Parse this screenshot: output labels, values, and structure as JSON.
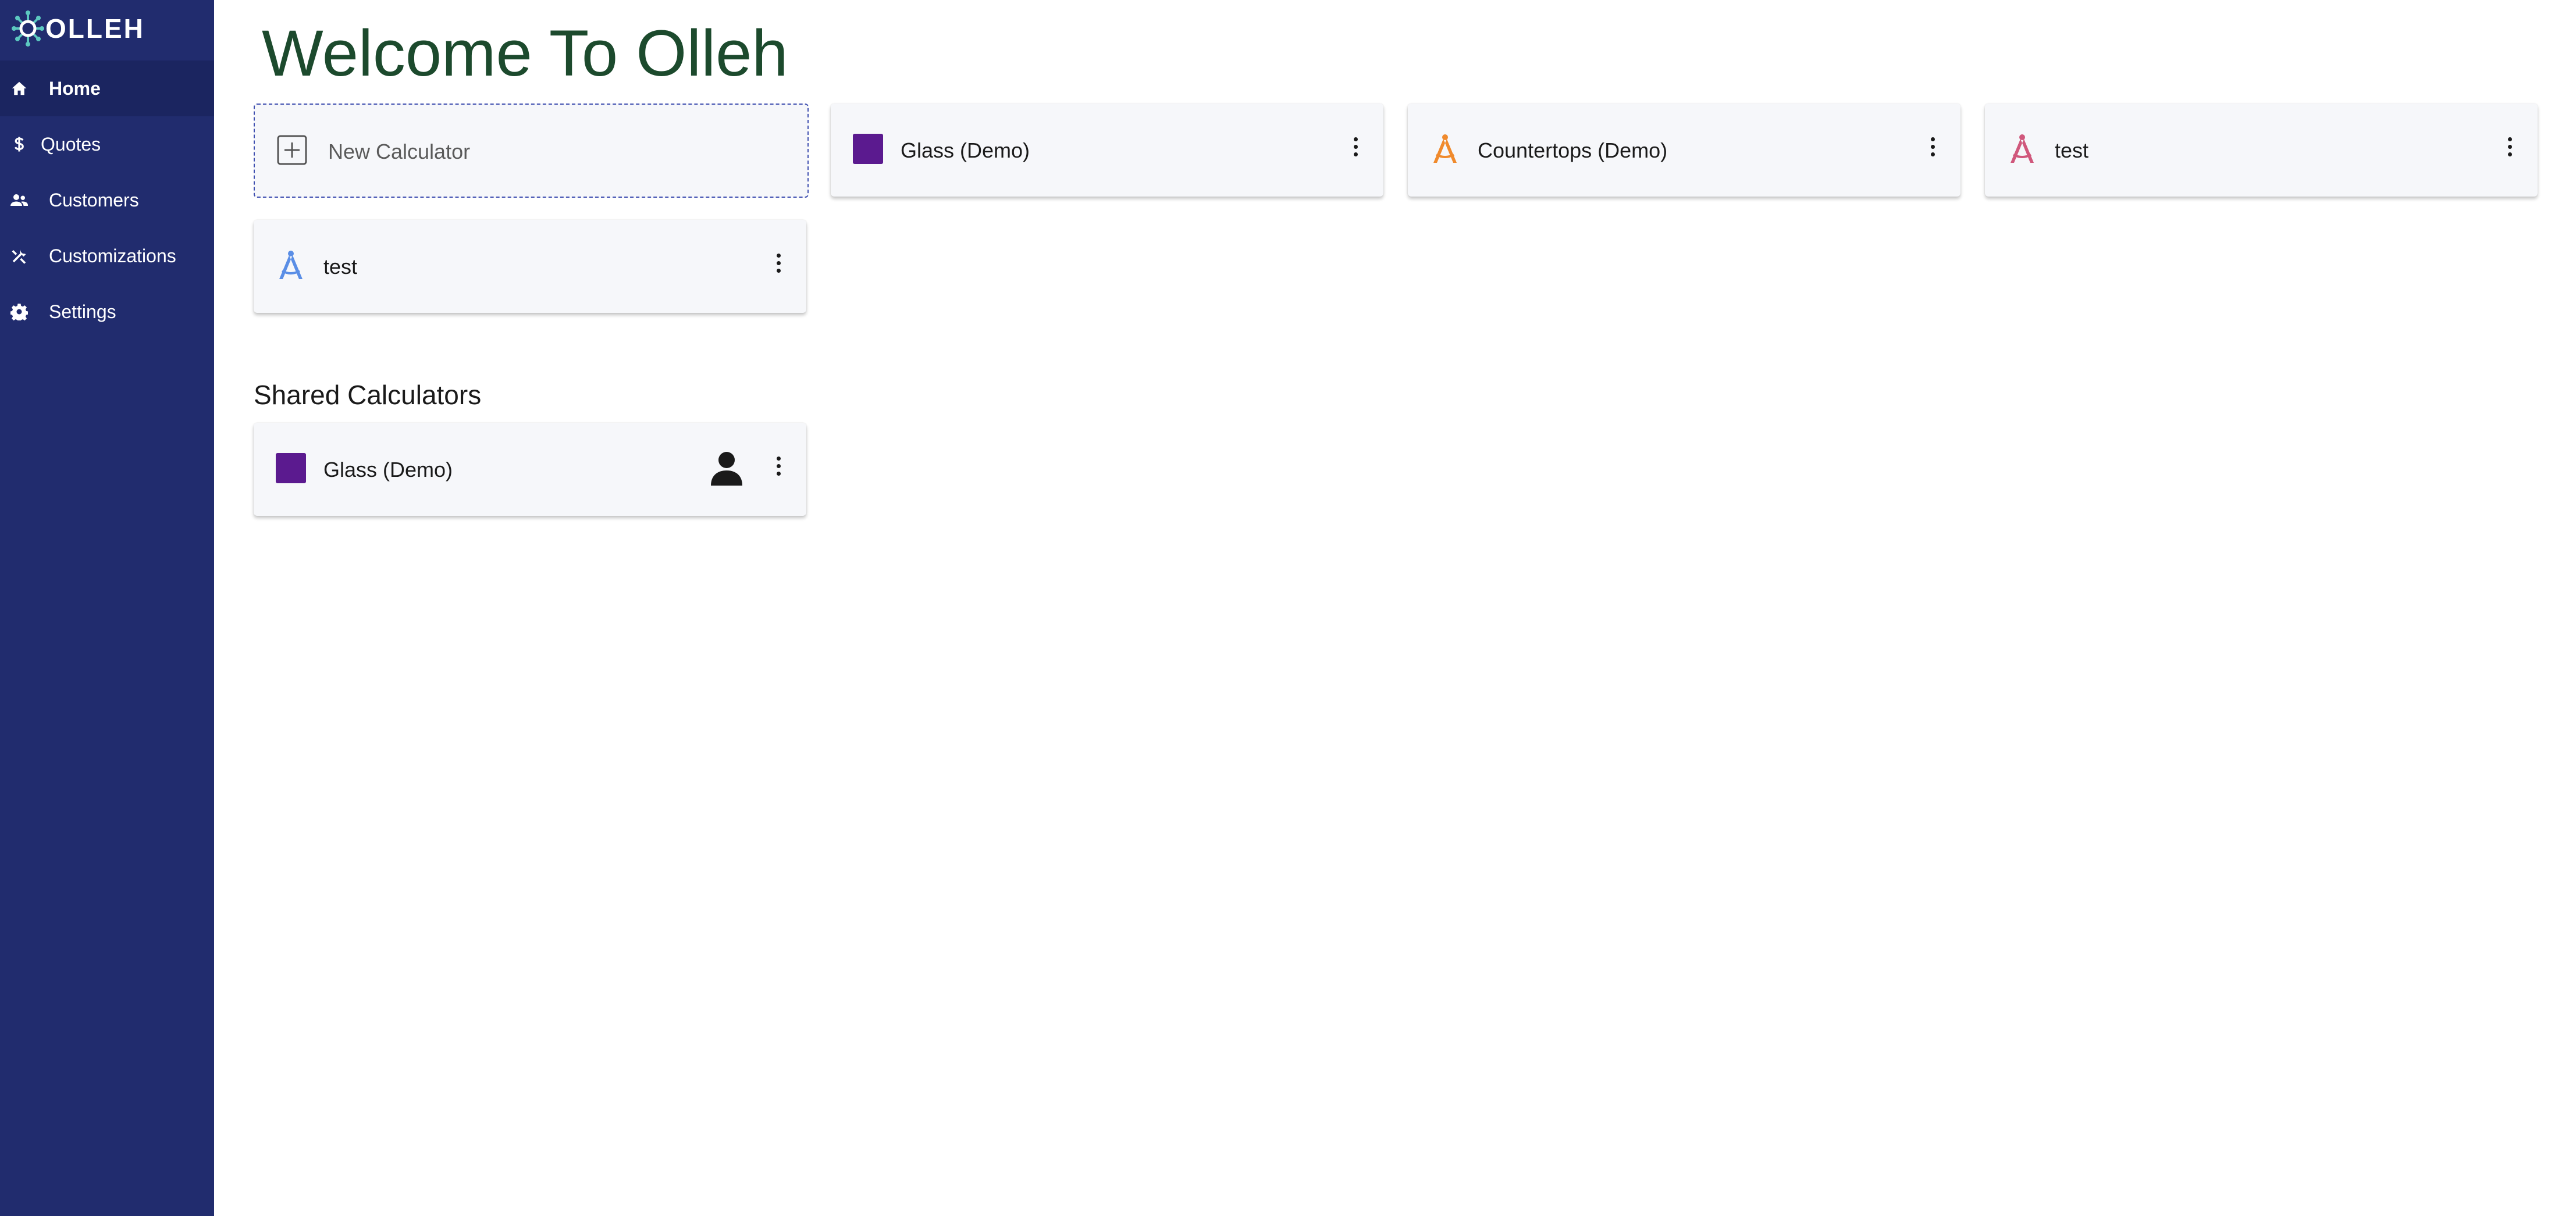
{
  "brand": {
    "name": "OLLEH",
    "accent": "#5cc8c0"
  },
  "sidebar": {
    "background": "#212c6e",
    "items": [
      {
        "label": "Home",
        "icon": "home-icon",
        "active": true
      },
      {
        "label": "Quotes",
        "icon": "dollar-icon",
        "active": false
      },
      {
        "label": "Customers",
        "icon": "people-icon",
        "active": false
      },
      {
        "label": "Customizations",
        "icon": "tools-icon",
        "active": false
      },
      {
        "label": "Settings",
        "icon": "gear-icon",
        "active": false
      }
    ]
  },
  "main": {
    "title": "Welcome To Olleh",
    "new_calculator_label": "New Calculator",
    "calculators": [
      {
        "name": "Glass (Demo)",
        "icon": "purple-square-icon",
        "color": "#5b1a8f"
      },
      {
        "name": "Countertops (Demo)",
        "icon": "compass-icon",
        "color": "#f08a2c"
      },
      {
        "name": "test",
        "icon": "compass-icon",
        "color": "#d0587c"
      },
      {
        "name": "test",
        "icon": "compass-icon",
        "color": "#5a8ee6"
      }
    ],
    "shared_title": "Shared Calculators",
    "shared": [
      {
        "name": "Glass (Demo)",
        "icon": "purple-square-icon",
        "color": "#5b1a8f",
        "owner_icon": "person-icon"
      }
    ]
  }
}
